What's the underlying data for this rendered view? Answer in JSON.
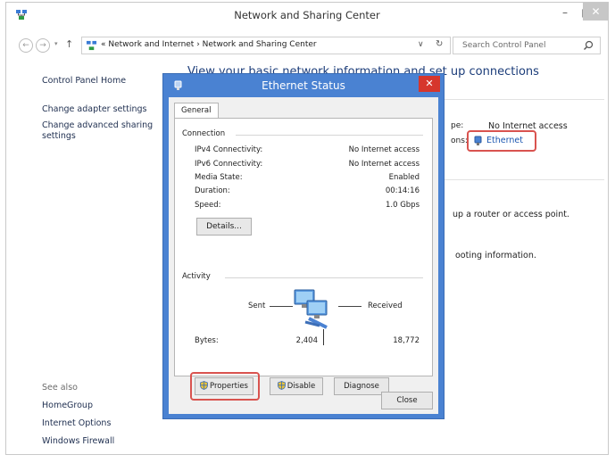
{
  "window": {
    "title": "Network and Sharing Center",
    "minimize": "–",
    "maximize": "□",
    "close": "✕"
  },
  "address_bar": {
    "back": "←",
    "forward": "→",
    "recent": "▾",
    "up": "↑",
    "path": "«  Network and Internet  ›  Network and Sharing Center",
    "dropdown": "∨",
    "refresh": "↻",
    "search_placeholder": "Search Control Panel"
  },
  "left_pane": {
    "home": "Control Panel Home",
    "change_adapter": "Change adapter settings",
    "change_advanced": "Change advanced sharing settings",
    "see_also": "See also",
    "homegroup": "HomeGroup",
    "internet_options": "Internet Options",
    "windows_firewall": "Windows Firewall"
  },
  "main": {
    "heading": "View your basic network information and set up connections",
    "access_type_label": "pe:",
    "access_type_value": "No Internet access",
    "connections_label": "ons:",
    "connection_link": "Ethernet",
    "router_text": "up a router or access point.",
    "troubleshoot_text": "ooting information."
  },
  "dialog": {
    "title": "Ethernet Status",
    "close": "✕",
    "tab": "General",
    "connection_group": "Connection",
    "properties": [
      {
        "label": "IPv4 Connectivity:",
        "value": "No Internet access"
      },
      {
        "label": "IPv6 Connectivity:",
        "value": "No Internet access"
      },
      {
        "label": "Media State:",
        "value": "Enabled"
      },
      {
        "label": "Duration:",
        "value": "00:14:16"
      },
      {
        "label": "Speed:",
        "value": "1.0 Gbps"
      }
    ],
    "details_button": "Details...",
    "activity_group": "Activity",
    "sent_label": "Sent",
    "received_label": "Received",
    "bytes_label": "Bytes:",
    "bytes_sent": "2,404",
    "bytes_received": "18,772",
    "properties_button": "Properties",
    "disable_button": "Disable",
    "diagnose_button": "Diagnose",
    "close_button": "Close"
  },
  "colors": {
    "dialog_frame": "#4a82d2",
    "close_red": "#d6362c",
    "highlight": "#d9534f",
    "link": "#1a56b0"
  }
}
